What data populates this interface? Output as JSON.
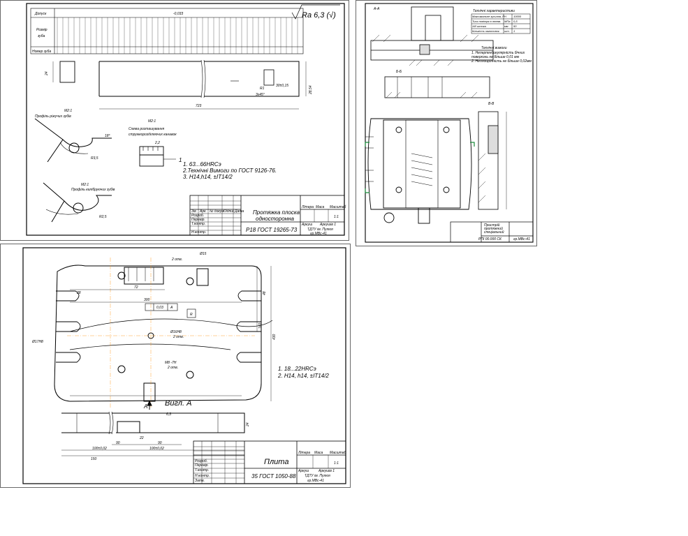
{
  "sheet1": {
    "table": {
      "row_label_1": "Допуск",
      "row_label_2a": "Розмір",
      "row_label_2b": "зуба",
      "row_label_3": "Номер зуба",
      "tolerance": "-0,033",
      "roughness": "Ra 6,3 (√)"
    },
    "dims": {
      "d1": "24",
      "d2": "723",
      "d3": "28,54",
      "d4": "R1",
      "d5": "3x45°",
      "d6": "30±0,15",
      "d7": "R3,5",
      "d8": "R2,5",
      "d9": "18°",
      "d10": "2,2",
      "d11": "1,5"
    },
    "labels": {
      "profile1": "Профіль ріжучих зубів",
      "profile2": "Профіль калібруючих зубів",
      "scale1": "М2:1",
      "scale2": "М2:1",
      "scale3": "М2:1",
      "chip_title1": "Схема розташування",
      "chip_title2": "стружкорозділяючих канавок",
      "marker": "1"
    },
    "notes": [
      "1. 63...66HRCэ",
      "2.Технічні Вимоги по ГОСТ 9126-76.",
      "3. H14,h14, ±IT14/2"
    ],
    "stamp": {
      "title1": "Протяжка плоска",
      "title2": "односторонна",
      "material": "Р18 ГОСТ 19265-73",
      "litera": "Літера",
      "mass": "Маса",
      "scale": "Масштаб",
      "scale_value": "1:1",
      "sheet": "Аркуш",
      "sheets": "Аркушів 1",
      "org1": "ТДТУ ім. Пулюя",
      "org2": "гр.МВс-41",
      "rows": [
        "Розроб.",
        "Перевір.",
        "Т.контр.",
        "Н.контр.",
        "Затв."
      ],
      "cols": [
        "Зм.",
        "Арк.",
        "№ докум.",
        "Підпис",
        "Дата"
      ]
    }
  },
  "sheet2": {
    "heading": "Технічні характеристики",
    "specs": [
      [
        "Максимальне зусилля, Р",
        "Н",
        "10000"
      ],
      [
        "Тиск повітря в пневм.",
        "МПа",
        "0,5"
      ],
      [
        "Хід штока",
        "мм",
        "50"
      ],
      [
        "Кількість заготовок",
        "шт.",
        "1"
      ]
    ],
    "tech_title": "Технічні вимоги",
    "tech_notes": [
      "1. Неперпендикулярність бічних",
      "поверхонь не більше 0,01 мм",
      "2. Неплощинність не більше 0,02мм"
    ],
    "sections": [
      "Б-Б",
      "В-В",
      "А-А"
    ],
    "stamp": {
      "title1": "Пристрій",
      "title2": "протяжний",
      "title3": "спеціальний",
      "code": "РПІ 00.000 СК",
      "org": "гр.МВс-41"
    }
  },
  "sheet3": {
    "dims": {
      "d1": "Ø15",
      "d2": "2 отв.",
      "d3": "72",
      "d4": "300",
      "d5": "0,03",
      "d6": "A",
      "d7": "Ø16Н8",
      "d8": "2 отв.",
      "d9": "R",
      "d10": "М8 -7Н",
      "d11": "2 отв.",
      "d12": "48",
      "d13": "160",
      "d14": "430",
      "d15": "Ø17Н8",
      "d16": "28",
      "d17": "100±0,02",
      "d18": "100±0,02",
      "d19": "150",
      "d20": "90",
      "d21": "22",
      "d22": "6,3",
      "d23": "24"
    },
    "labels": {
      "view": "Вигл. А",
      "arrow": "А"
    },
    "notes": [
      "1. 18...22HRCэ",
      "2. H14, h14, ±IT14/2"
    ],
    "stamp": {
      "title": "Плита",
      "material": "35 ГОСТ 1050-88",
      "litera": "Літера",
      "mass": "Маса",
      "scale": "Масштаб",
      "scale_value": "1:1",
      "sheet": "Аркуш",
      "sheets": "Аркушів 1",
      "org1": "ТДТУ ім. Пулюя",
      "org2": "гр.МВс-41",
      "rows": [
        "Розроб.",
        "Перевір.",
        "Т.контр.",
        "Н.контр.",
        "Затв."
      ]
    }
  }
}
